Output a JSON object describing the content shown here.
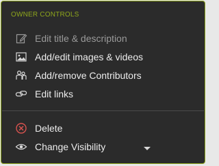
{
  "menu": {
    "heading": "OWNER CONTROLS",
    "items": [
      {
        "label": "Edit title & description",
        "icon": "pencil-icon"
      },
      {
        "label": "Add/edit images & videos",
        "icon": "image-icon"
      },
      {
        "label": "Add/remove Contributors",
        "icon": "contributors-icon"
      },
      {
        "label": "Edit links",
        "icon": "link-icon"
      }
    ],
    "delete_label": "Delete",
    "visibility_label": "Change Visibility"
  },
  "colors": {
    "accent": "#8ea61c",
    "panel_bg": "#2b2b2b",
    "danger": "#d9534f",
    "text": "#ececec",
    "muted_text": "#9a9a9a"
  }
}
